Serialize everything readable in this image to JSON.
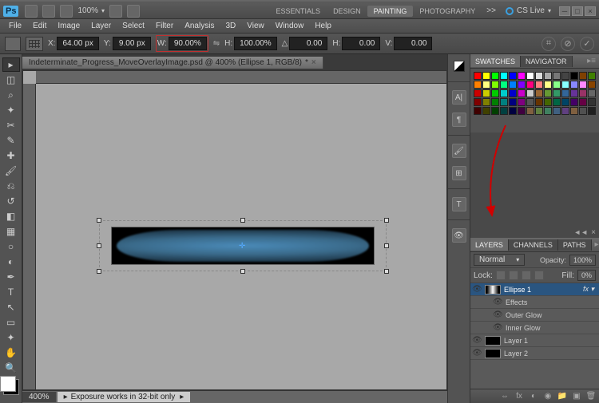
{
  "app": {
    "logo": "Ps",
    "cslive": "CS Live"
  },
  "top_zoom": "100%",
  "workspaces": {
    "items": [
      "ESSENTIALS",
      "DESIGN",
      "PAINTING",
      "PHOTOGRAPHY"
    ],
    "active": 2,
    "more": ">>"
  },
  "menu": [
    "File",
    "Edit",
    "Image",
    "Layer",
    "Select",
    "Filter",
    "Analysis",
    "3D",
    "View",
    "Window",
    "Help"
  ],
  "options": {
    "x_label": "X:",
    "x": "64.00 px",
    "y_label": "Y:",
    "y": "9.00 px",
    "w_label": "W:",
    "w": "90.00%",
    "h_label": "H:",
    "h": "100.00%",
    "angle_label": "△",
    "angle": "0.00",
    "skewh_label": "H:",
    "skewh": "0.00",
    "skewv_label": "V:",
    "skewv": "0.00"
  },
  "doc_tab": {
    "title": "Indeterminate_Progress_MoveOverlayImage.psd @ 400% (Ellipse 1, RGB/8)",
    "dirty": "*"
  },
  "status": {
    "zoom": "400%",
    "text": "Exposure works in 32-bit only"
  },
  "swatches_panel": {
    "tabs": [
      "SWATCHES",
      "NAVIGATOR"
    ],
    "active": 0
  },
  "layers_panel": {
    "tabs": [
      "LAYERS",
      "CHANNELS",
      "PATHS"
    ],
    "active": 0,
    "blend": "Normal",
    "opacity_label": "Opacity:",
    "opacity": "100%",
    "lock_label": "Lock:",
    "fill_label": "Fill:",
    "fill": "0%",
    "layers": [
      {
        "name": "Ellipse 1",
        "selected": true,
        "fx": true,
        "effects": [
          "Effects",
          "Outer Glow",
          "Inner Glow"
        ]
      },
      {
        "name": "Layer 1"
      },
      {
        "name": "Layer 2"
      }
    ]
  },
  "swatch_colors": [
    "#ff0000",
    "#ffff00",
    "#00ff00",
    "#00ffff",
    "#0000ff",
    "#ff00ff",
    "#ffffff",
    "#dddddd",
    "#aaaaaa",
    "#777777",
    "#444444",
    "#000000",
    "#804000",
    "#408000",
    "#ff8000",
    "#ffff80",
    "#80ff00",
    "#00ff80",
    "#0080ff",
    "#8000ff",
    "#ff0080",
    "#ff8080",
    "#ffff88",
    "#88ff88",
    "#88ffff",
    "#8888ff",
    "#ff88ff",
    "#884400",
    "#cc0000",
    "#cccc00",
    "#00cc00",
    "#00cccc",
    "#0000cc",
    "#cc00cc",
    "#cccccc",
    "#996633",
    "#669933",
    "#339966",
    "#336699",
    "#663399",
    "#993366",
    "#666666",
    "#800000",
    "#808000",
    "#008000",
    "#008080",
    "#000080",
    "#800080",
    "#555555",
    "#663300",
    "#446600",
    "#006644",
    "#004466",
    "#440066",
    "#660044",
    "#333333",
    "#400000",
    "#404000",
    "#004000",
    "#004040",
    "#000040",
    "#400040",
    "#806040",
    "#608040",
    "#408060",
    "#406080",
    "#604080",
    "#806040",
    "#505050",
    "#202020"
  ]
}
